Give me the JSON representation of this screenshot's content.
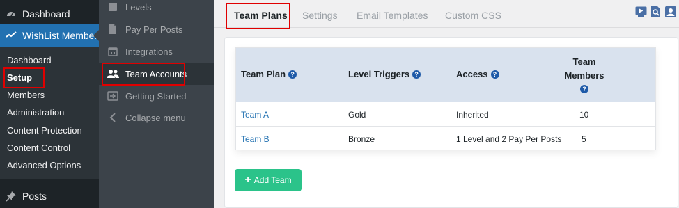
{
  "wp_menu": {
    "dashboard": "Dashboard",
    "wishlist": "WishList Member",
    "submenu": [
      "Dashboard",
      "Setup",
      "Members",
      "Administration",
      "Content Protection",
      "Content Control",
      "Advanced Options"
    ],
    "posts": "Posts"
  },
  "plugin_menu": {
    "levels": "Levels",
    "pay_per_posts": "Pay Per Posts",
    "integrations": "Integrations",
    "team_accounts": "Team Accounts",
    "getting_started": "Getting Started",
    "collapse": "Collapse menu"
  },
  "tabs": [
    "Team Plans",
    "Settings",
    "Email Templates",
    "Custom CSS"
  ],
  "table": {
    "headers": {
      "team_plan": "Team Plan",
      "level_triggers": "Level Triggers",
      "access": "Access",
      "team_members_1": "Team",
      "team_members_2": "Members"
    },
    "help_glyph": "?",
    "rows": [
      {
        "plan": "Team A",
        "trigger": "Gold",
        "access": "Inherited",
        "members": "10"
      },
      {
        "plan": "Team B",
        "trigger": "Bronze",
        "access": "1 Level and 2 Pay Per Posts",
        "members": "5"
      }
    ]
  },
  "add_button": "Add Team",
  "colors": {
    "highlight": "#e00000",
    "accent": "#2271b1",
    "add_button": "#2bc38a",
    "help_badge": "#1e5aa8"
  },
  "icons": [
    "dashboard-icon",
    "wishlist-icon",
    "pin-icon",
    "levels-icon",
    "pay-per-posts-icon",
    "integrations-icon",
    "team-accounts-icon",
    "getting-started-icon",
    "collapse-icon",
    "video-icon",
    "search-doc-icon",
    "user-icon",
    "help-icon",
    "plus-icon"
  ]
}
